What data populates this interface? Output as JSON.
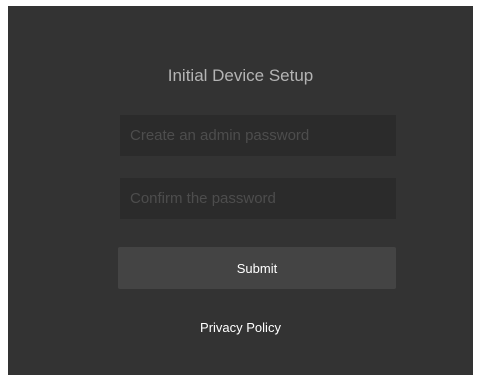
{
  "setup": {
    "title": "Initial Device Setup",
    "password_placeholder": "Create an admin password",
    "password_value": "",
    "confirm_placeholder": "Confirm the password",
    "confirm_value": "",
    "submit_label": "Submit",
    "privacy_label": "Privacy Policy"
  },
  "colors": {
    "background": "#333333",
    "field_background": "#2b2b2b",
    "button_background": "#444444",
    "title_text": "#b4b4b4",
    "placeholder_text": "#4d4d4d",
    "button_text": "#ffffff"
  }
}
